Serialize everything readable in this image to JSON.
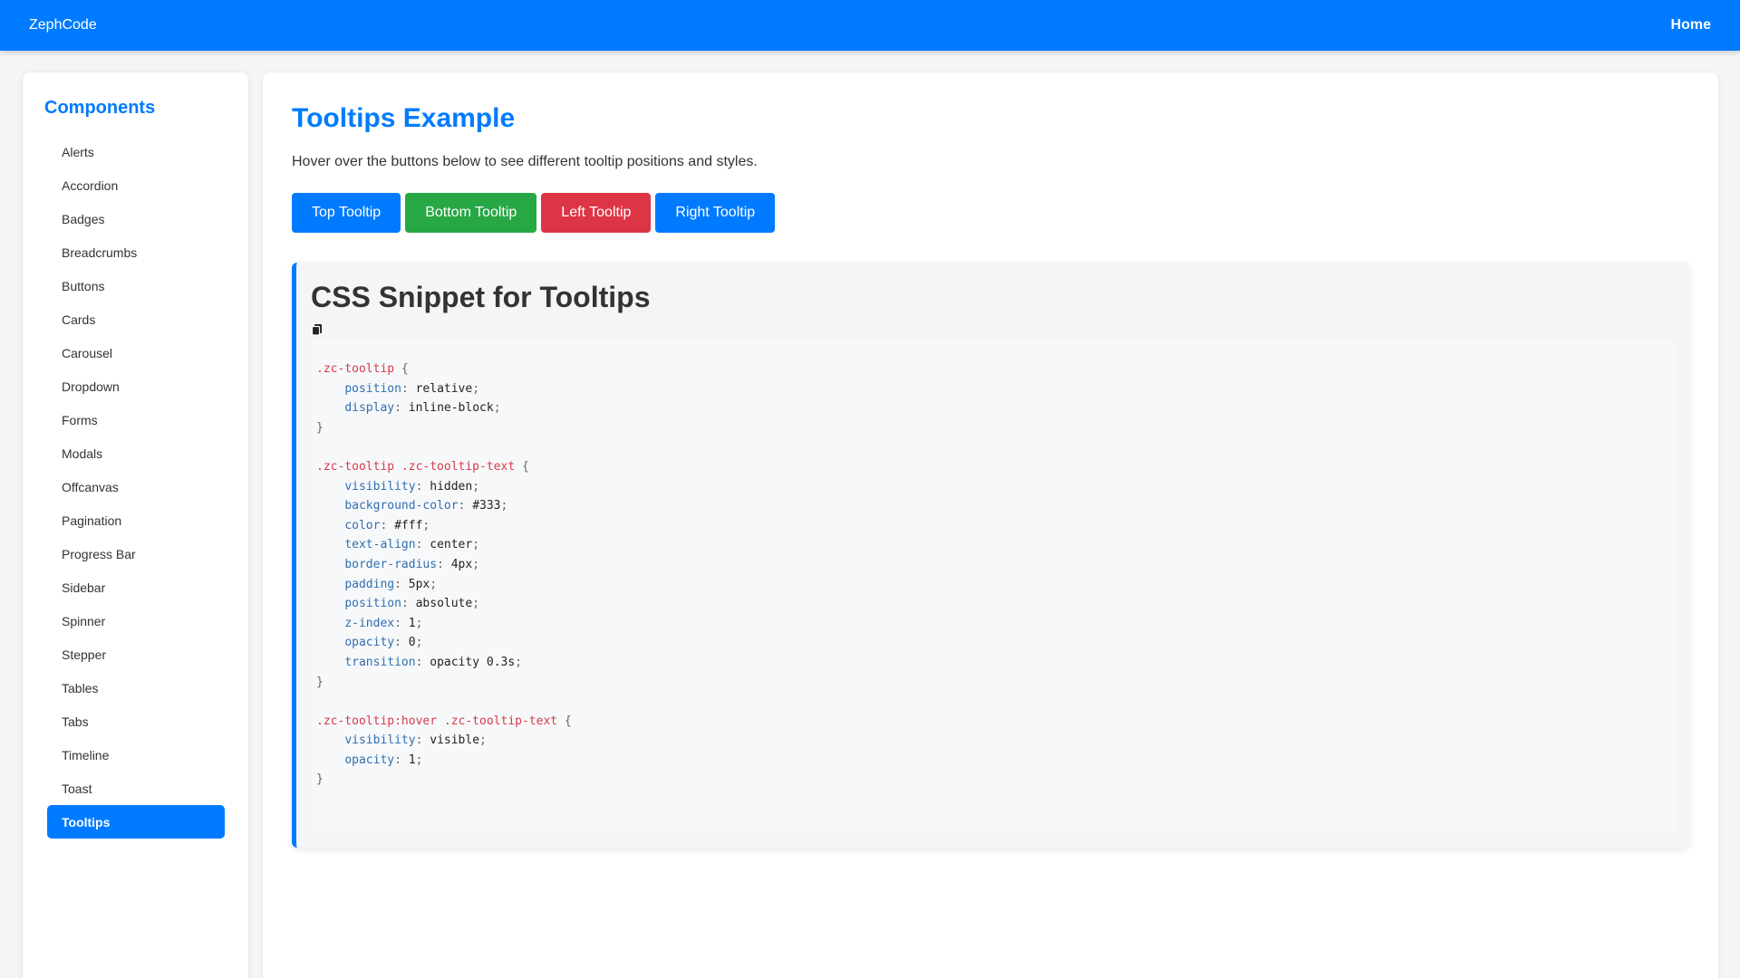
{
  "navbar": {
    "brand": "ZephCode",
    "home": "Home"
  },
  "sidebar": {
    "title": "Components",
    "items": [
      "Alerts",
      "Accordion",
      "Badges",
      "Breadcrumbs",
      "Buttons",
      "Cards",
      "Carousel",
      "Dropdown",
      "Forms",
      "Modals",
      "Offcanvas",
      "Pagination",
      "Progress Bar",
      "Sidebar",
      "Spinner",
      "Stepper",
      "Tables",
      "Tabs",
      "Timeline",
      "Toast",
      "Tooltips"
    ],
    "active": "Tooltips"
  },
  "main": {
    "title": "Tooltips Example",
    "description": "Hover over the buttons below to see different tooltip positions and styles.",
    "buttons": [
      {
        "label": "Top Tooltip",
        "color": "#007bff"
      },
      {
        "label": "Bottom Tooltip",
        "color": "#28a745"
      },
      {
        "label": "Left Tooltip",
        "color": "#dc3545"
      },
      {
        "label": "Right Tooltip",
        "color": "#007bff"
      }
    ]
  },
  "snippet": {
    "title": "CSS Snippet for Tooltips",
    "copy_icon": "copy-icon",
    "rules": [
      {
        "selector": ".zc-tooltip",
        "decls": [
          [
            "position",
            "relative"
          ],
          [
            "display",
            "inline-block"
          ]
        ]
      },
      {
        "selector": ".zc-tooltip .zc-tooltip-text",
        "decls": [
          [
            "visibility",
            "hidden"
          ],
          [
            "background-color",
            "#333"
          ],
          [
            "color",
            "#fff"
          ],
          [
            "text-align",
            "center"
          ],
          [
            "border-radius",
            "4px"
          ],
          [
            "padding",
            "5px"
          ],
          [
            "position",
            "absolute"
          ],
          [
            "z-index",
            "1"
          ],
          [
            "opacity",
            "0"
          ],
          [
            "transition",
            "opacity 0.3s"
          ]
        ]
      },
      {
        "selector": ".zc-tooltip:hover .zc-tooltip-text",
        "decls": [
          [
            "visibility",
            "visible"
          ],
          [
            "opacity",
            "1"
          ]
        ]
      }
    ]
  },
  "colors": {
    "primary": "#007bff",
    "success": "#28a745",
    "danger": "#dc3545"
  }
}
